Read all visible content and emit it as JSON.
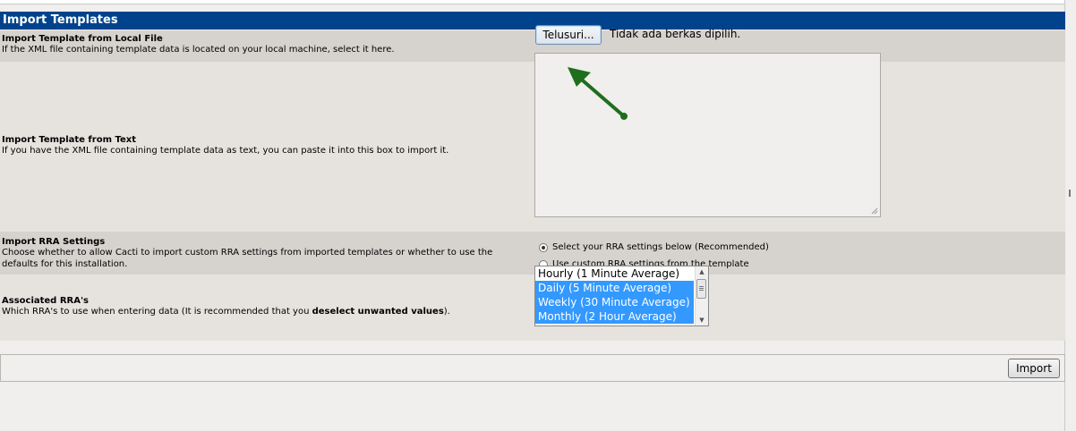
{
  "header": {
    "title": "Import Templates"
  },
  "local_file": {
    "title": "Import Template from Local File",
    "description": "If the XML file containing template data is located on your local machine, select it here.",
    "browse_label": "Telusuri...",
    "status": "Tidak ada berkas dipilih."
  },
  "text_import": {
    "title": "Import Template from Text",
    "description": "If you have the XML file containing template data as text, you can paste it into this box to import it.",
    "value": ""
  },
  "rra_settings": {
    "title": "Import RRA Settings",
    "description": "Choose whether to allow Cacti to import custom RRA settings from imported templates or whether to use the defaults for this installation.",
    "options": [
      {
        "label": "Select your RRA settings below (Recommended)",
        "selected": true
      },
      {
        "label": "Use custom RRA settings from the template",
        "selected": false
      }
    ]
  },
  "associated_rras": {
    "title": "Associated RRA's",
    "description_prefix": "Which RRA's to use when entering data (It is recommended that you ",
    "description_bold": "deselect unwanted values",
    "description_suffix": ").",
    "items": [
      {
        "label": "Hourly (1 Minute Average)",
        "selected": false
      },
      {
        "label": "Daily (5 Minute Average)",
        "selected": true
      },
      {
        "label": "Weekly (30 Minute Average)",
        "selected": true
      },
      {
        "label": "Monthly (2 Hour Average)",
        "selected": true
      }
    ]
  },
  "footer": {
    "import_label": "Import"
  },
  "colors": {
    "header_bg": "#00438c",
    "selection": "#3399ff",
    "arrow": "#1e6e1e"
  }
}
